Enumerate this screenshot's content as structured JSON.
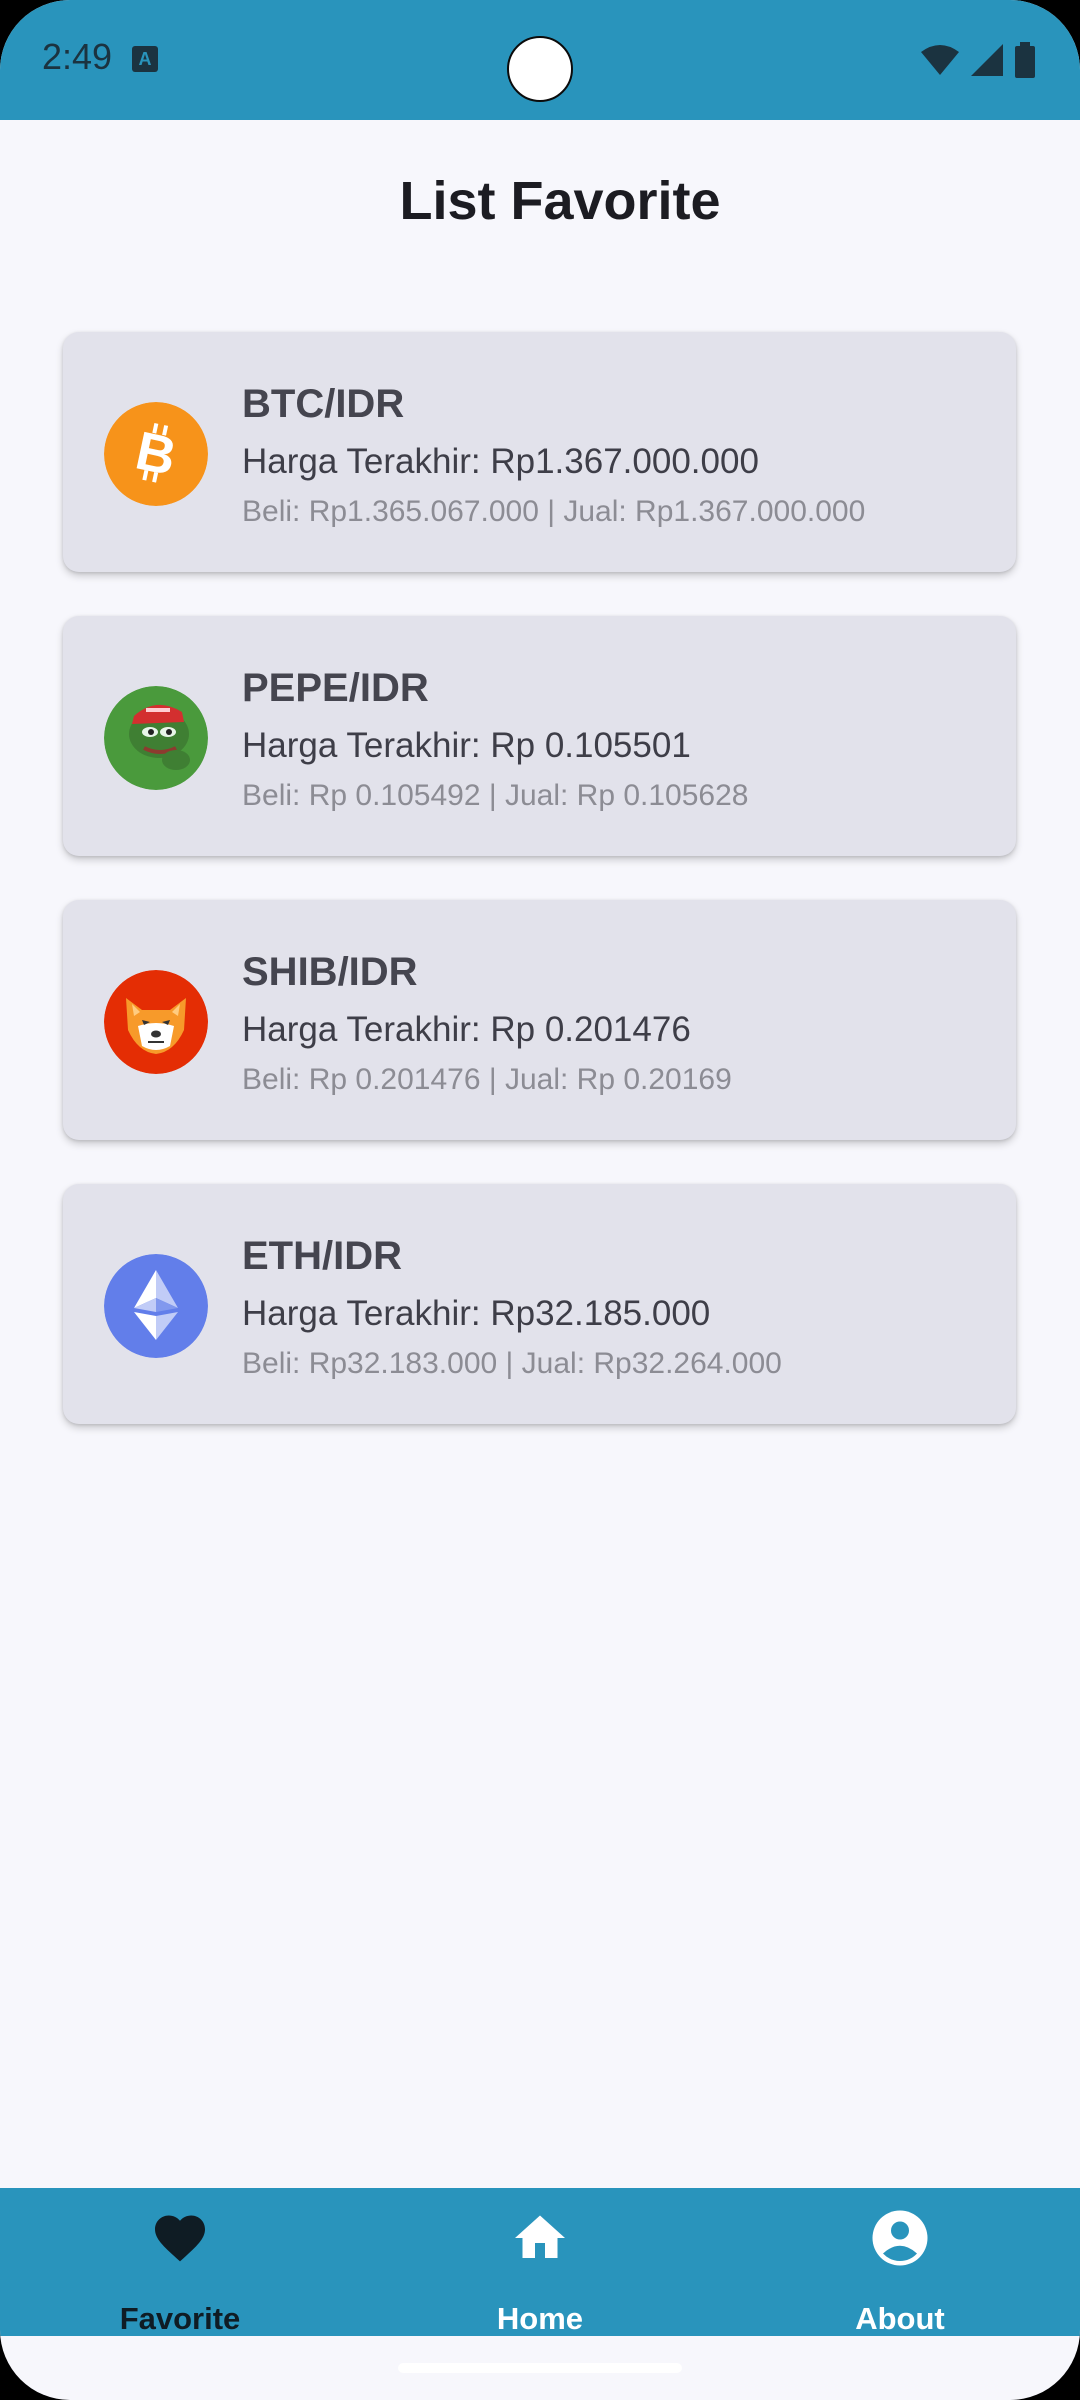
{
  "status_bar": {
    "time": "2:49",
    "icons": [
      "keyboard-a-icon",
      "wifi-icon",
      "signal-icon",
      "battery-icon"
    ]
  },
  "page": {
    "title": "List Favorite"
  },
  "favorites": [
    {
      "icon": "bitcoin-icon",
      "pair": "BTC/IDR",
      "last_price": "Harga Terakhir: Rp1.367.000.000",
      "bid_ask": "Beli: Rp1.365.067.000 | Jual: Rp1.367.000.000"
    },
    {
      "icon": "pepe-icon",
      "pair": "PEPE/IDR",
      "last_price": "Harga Terakhir: Rp 0.105501",
      "bid_ask": "Beli: Rp 0.105492 | Jual: Rp 0.105628"
    },
    {
      "icon": "shiba-inu-icon",
      "pair": "SHIB/IDR",
      "last_price": "Harga Terakhir: Rp 0.201476",
      "bid_ask": "Beli: Rp 0.201476 | Jual: Rp 0.20169"
    },
    {
      "icon": "ethereum-icon",
      "pair": "ETH/IDR",
      "last_price": "Harga Terakhir: Rp32.185.000",
      "bid_ask": "Beli: Rp32.183.000 | Jual: Rp32.264.000"
    }
  ],
  "bottom_nav": {
    "items": [
      {
        "label": "Favorite",
        "icon": "heart-icon",
        "active": true
      },
      {
        "label": "Home",
        "icon": "home-icon",
        "active": false
      },
      {
        "label": "About",
        "icon": "account-circle-icon",
        "active": false
      }
    ]
  },
  "colors": {
    "bar": "#2994bc",
    "background": "#f7f7fc",
    "card": "#e2e2eb",
    "nav_active": "#0f1c24",
    "nav_inactive": "#ffffff"
  }
}
